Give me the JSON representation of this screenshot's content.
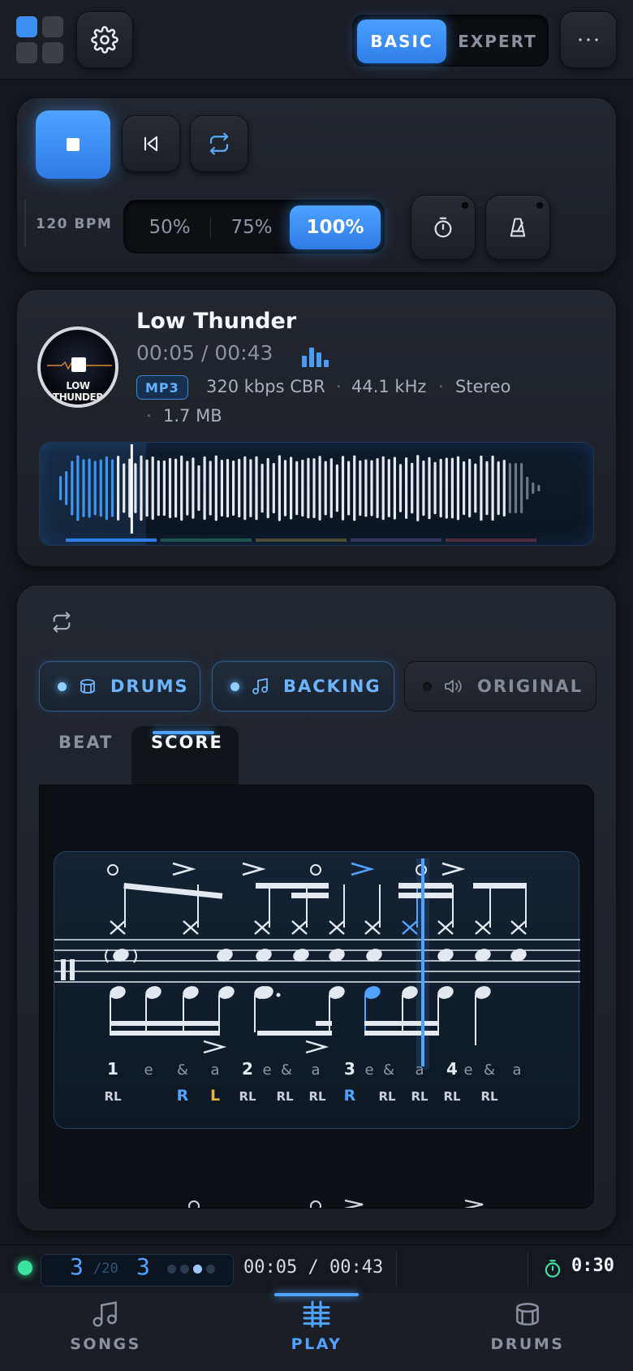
{
  "header": {
    "mode_options": [
      "BASIC",
      "EXPERT"
    ],
    "active_mode": "BASIC",
    "icons": [
      "app-grid-icon",
      "gear-icon",
      "more-dots-icon"
    ]
  },
  "transport": {
    "bpm_label": "120 BPM",
    "speeds": [
      "50%",
      "75%",
      "100%"
    ],
    "active_speed": "100%",
    "icons": [
      "stop-icon",
      "skip-back-icon",
      "loop-icon",
      "timer-icon",
      "metronome-icon"
    ]
  },
  "player": {
    "album_text": "LOW THUNDER",
    "title": "Low Thunder",
    "time": "00:05 / 00:43",
    "format": "MP3",
    "bitrate": "320 kbps CBR",
    "sample_rate": "44.1 kHz",
    "channels": "Stereo",
    "size": "1.7 MB",
    "sep": "·",
    "progress": 0.11,
    "accent": "#4ea3ff"
  },
  "practice": {
    "channels": [
      {
        "label": "DRUMS",
        "on": true,
        "icon": "drum-icon"
      },
      {
        "label": "BACKING",
        "on": true,
        "icon": "music-note-icon"
      },
      {
        "label": "ORIGINAL",
        "on": false,
        "icon": "speaker-icon"
      }
    ],
    "tabs": [
      "BEAT",
      "SCORE"
    ],
    "active_tab": "SCORE",
    "counts": [
      "1",
      "e",
      "&",
      "a",
      "2",
      "e",
      "&",
      "a",
      "3",
      "e",
      "&",
      "a",
      "4",
      "e",
      "&",
      "a"
    ],
    "stickings": [
      "RL",
      "R",
      "L",
      "RL",
      "RL",
      "RL",
      "R",
      "RL",
      "RL",
      "RL",
      "RL"
    ]
  },
  "status": {
    "bar_current": "3",
    "bar_total": "/20",
    "beat": "3",
    "time": "00:05 / 00:43",
    "timer": "0:30",
    "live_color": "#3fe3a0"
  },
  "nav": {
    "items": [
      {
        "label": "SONGS",
        "icon": "music-note-icon"
      },
      {
        "label": "PLAY",
        "icon": "score-lines-icon"
      },
      {
        "label": "DRUMS",
        "icon": "drum-icon"
      }
    ],
    "active": "PLAY"
  }
}
